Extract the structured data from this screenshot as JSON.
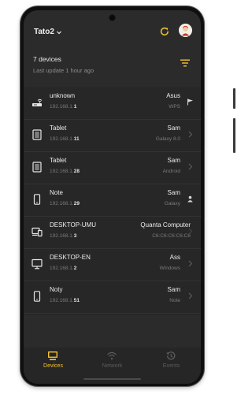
{
  "header": {
    "network_name": "Tato2",
    "dropdown_icon": "chevron-down-icon",
    "refresh_icon": "refresh-icon",
    "avatar_icon": "avatar"
  },
  "summary": {
    "device_count": "7 devices",
    "last_update": "Last update 1 hour ago",
    "filter_icon": "filter-icon"
  },
  "devices": [
    {
      "icon": "router-icon",
      "name": "unknown",
      "ip_prefix": "192.168.1.",
      "ip_suffix": "1",
      "vendor": "Asus",
      "model": "WPS",
      "right_icon": "flag-icon"
    },
    {
      "icon": "tablet-icon",
      "name": "Tablet",
      "ip_prefix": "192.168.1.",
      "ip_suffix": "11",
      "vendor": "Sam",
      "model": "Galaxy 8.0",
      "right_icon": "chevron-right-icon"
    },
    {
      "icon": "tablet-icon",
      "name": "Tablet",
      "ip_prefix": "192.168.1.",
      "ip_suffix": "28",
      "vendor": "Sam",
      "model": "Android",
      "right_icon": "chevron-right-icon"
    },
    {
      "icon": "phone-icon",
      "name": "Note",
      "ip_prefix": "192.168.1.",
      "ip_suffix": "29",
      "vendor": "Sam",
      "model": "Galaxy",
      "right_icon": "person-icon"
    },
    {
      "icon": "laptop-icon",
      "name": "DESKTOP-UMU",
      "ip_prefix": "192.168.1.",
      "ip_suffix": "3",
      "vendor": "Quanta Computer",
      "model": "C6:C6:C6:C6:C6",
      "right_icon": "chevron-right-icon"
    },
    {
      "icon": "monitor-icon",
      "name": "DESKTOP-EN",
      "ip_prefix": "192.168.1.",
      "ip_suffix": "2",
      "vendor": "Ass",
      "model": "Windows",
      "right_icon": "chevron-right-icon"
    },
    {
      "icon": "phone-icon",
      "name": "Noty",
      "ip_prefix": "192.168.1.",
      "ip_suffix": "51",
      "vendor": "Sam",
      "model": "Note",
      "right_icon": "chevron-right-icon"
    }
  ],
  "nav": {
    "devices": {
      "label": "Devices",
      "icon": "devices-icon",
      "active": true
    },
    "network": {
      "label": "Network",
      "icon": "wifi-icon",
      "active": false
    },
    "events": {
      "label": "Events",
      "icon": "history-icon",
      "active": false
    }
  },
  "colors": {
    "accent": "#f2c230",
    "background": "#2b2b2b",
    "list_background": "#272727",
    "text_primary": "#ececec",
    "text_secondary": "#7b7b7b"
  }
}
